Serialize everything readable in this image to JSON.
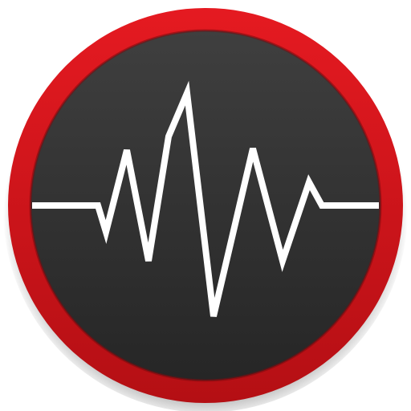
{
  "icon": {
    "name": "waveform-app-icon",
    "semantic": "heartbeat-waveform-icon",
    "colors": {
      "background": "#ffffff",
      "ring_outer": "#e0171d",
      "ring_inner": "#9a0f12",
      "face_top": "#3d3d3d",
      "face_bottom": "#262626",
      "waveform": "#ffffff"
    }
  }
}
